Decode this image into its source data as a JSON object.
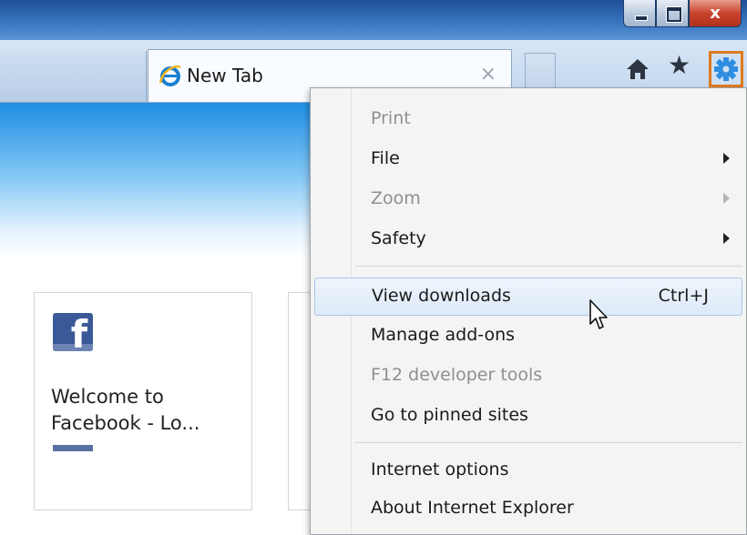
{
  "window": {
    "min_label": "minimize",
    "max_label": "maximize",
    "close_glyph": "x"
  },
  "tabs": {
    "active_title": "New Tab",
    "close_glyph": "×"
  },
  "toolbar": {
    "icons": [
      "home-icon",
      "favorites-star-icon",
      "tools-gear-icon"
    ],
    "highlight_color": "#e07a1f"
  },
  "content": {
    "tile1": {
      "title": "Welcome to Facebook - Lo...",
      "icon": "facebook-logo"
    }
  },
  "menu": {
    "items": [
      {
        "label": "Print",
        "disabled": true
      },
      {
        "label": "File",
        "submenu": true
      },
      {
        "label": "Zoom",
        "submenu": true,
        "disabled": true
      },
      {
        "label": "Safety",
        "submenu": true
      },
      {
        "label": "View downloads",
        "shortcut": "Ctrl+J",
        "hover": true
      },
      {
        "label": "Manage add-ons"
      },
      {
        "label": "F12 developer tools",
        "disabled": true
      },
      {
        "label": "Go to pinned sites"
      },
      {
        "label": "Internet options"
      },
      {
        "label": "About Internet Explorer"
      }
    ]
  }
}
